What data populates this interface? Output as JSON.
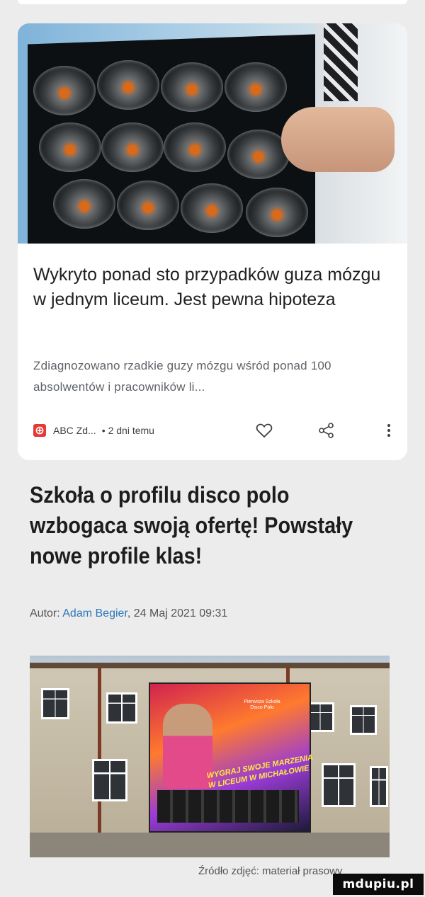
{
  "news_card": {
    "title": "Wykryto ponad sto przypadków guza mózgu w jednym liceum. Jest pewna hipoteza",
    "snippet": "Zdiagnozowano rzadkie guzy mózgu wśród ponad 100 absolwentów i pracowników li...",
    "source": "ABC Zd...",
    "separator": "•",
    "time": "2 dni temu",
    "icons": {
      "source": "abc-news-logo-icon",
      "like": "heart-icon",
      "share": "share-icon",
      "more": "more-vert-icon"
    }
  },
  "article": {
    "headline": "Szkoła o profilu disco polo wzbogaca swoją ofertę! Powstały nowe profile klas!",
    "author_label": "Autor:",
    "author": "Adam Begier",
    "date": ", 24 Maj 2021",
    "time": "09:31",
    "banner_text": {
      "brand": "Pierwsza Szkoła Disco Polo",
      "line1": "WYGRAJ SWOJE MARZENIA",
      "line2": "W LICEUM W MICHAŁOWIE"
    },
    "photo_caption": "Źródło zdjęć: materiał prasowy"
  },
  "watermark": "mdupiu.pl",
  "colors": {
    "accent_link": "#2b77b8",
    "source_logo": "#e53935",
    "card_bg": "#ffffff",
    "page_bg": "#ececec"
  }
}
